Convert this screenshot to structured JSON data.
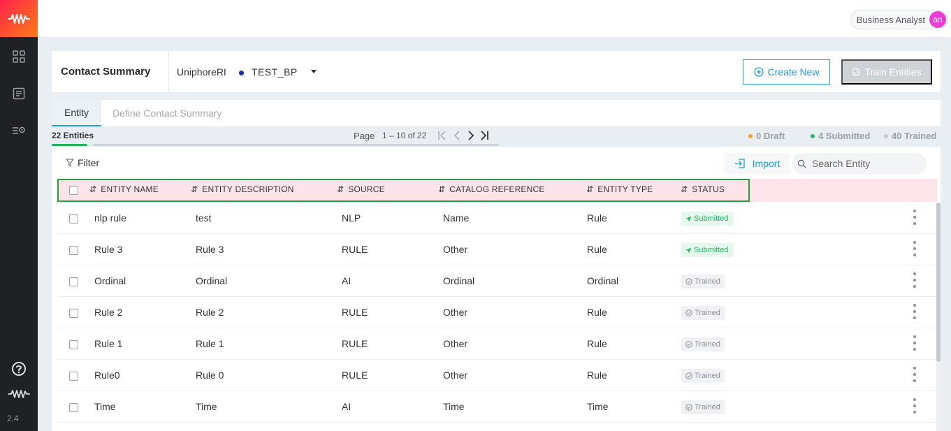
{
  "app": {
    "version": "2.4",
    "user_role": "Business Analyst",
    "user_initials": "an"
  },
  "header": {
    "title": "Contact Summary",
    "project": "UniphoreRI",
    "business_process": "TEST_BP",
    "create_label": "Create New",
    "train_label": "Train Entities"
  },
  "tabs": [
    {
      "label": "Entity",
      "active": true
    },
    {
      "label": "Define Contact Summary",
      "active": false
    }
  ],
  "info": {
    "entity_count": "22 Entities",
    "page_label": "Page",
    "page_range": "1 – 10 of 22",
    "stats": [
      {
        "label": "0 Draft",
        "color": "#f5a623"
      },
      {
        "label": "4 Submitted",
        "color": "#22b565"
      },
      {
        "label": "40 Trained",
        "color": "#c5c9ce"
      }
    ]
  },
  "toolbar": {
    "filter_label": "Filter",
    "import_label": "Import",
    "search_placeholder": "Search Entity"
  },
  "table": {
    "columns": [
      "ENTITY NAME",
      "ENTITY DESCRIPTION",
      "SOURCE",
      "CATALOG REFERENCE",
      "ENTITY TYPE",
      "STATUS"
    ],
    "rows": [
      {
        "name": "nlp rule",
        "description": "test",
        "source": "NLP",
        "catalog": "Name",
        "type": "Rule",
        "status": "Submitted"
      },
      {
        "name": "Rule 3",
        "description": "Rule 3",
        "source": "RULE",
        "catalog": "Other",
        "type": "Rule",
        "status": "Submitted"
      },
      {
        "name": "Ordinal",
        "description": "Ordinal",
        "source": "AI",
        "catalog": "Ordinal",
        "type": "Ordinal",
        "status": "Trained"
      },
      {
        "name": "Rule 2",
        "description": "Rule 2",
        "source": "RULE",
        "catalog": "Other",
        "type": "Rule",
        "status": "Trained"
      },
      {
        "name": "Rule 1",
        "description": "Rule 1",
        "source": "RULE",
        "catalog": "Other",
        "type": "Rule",
        "status": "Trained"
      },
      {
        "name": "Rule0",
        "description": "Rule 0",
        "source": "RULE",
        "catalog": "Other",
        "type": "Rule",
        "status": "Trained"
      },
      {
        "name": "Time",
        "description": "Time",
        "source": "AI",
        "catalog": "Time",
        "type": "Time",
        "status": "Trained"
      }
    ]
  },
  "colors": {
    "accent": "#1e9fe0",
    "header_highlight": "#fde4ea",
    "submitted": "#22b565",
    "outline": "#23a23a"
  },
  "icons": {
    "logo": "waveform-logo-icon",
    "dashboard": "grid-icon",
    "documents": "document-icon",
    "settings": "list-gear-icon",
    "help": "help-circle-icon"
  }
}
